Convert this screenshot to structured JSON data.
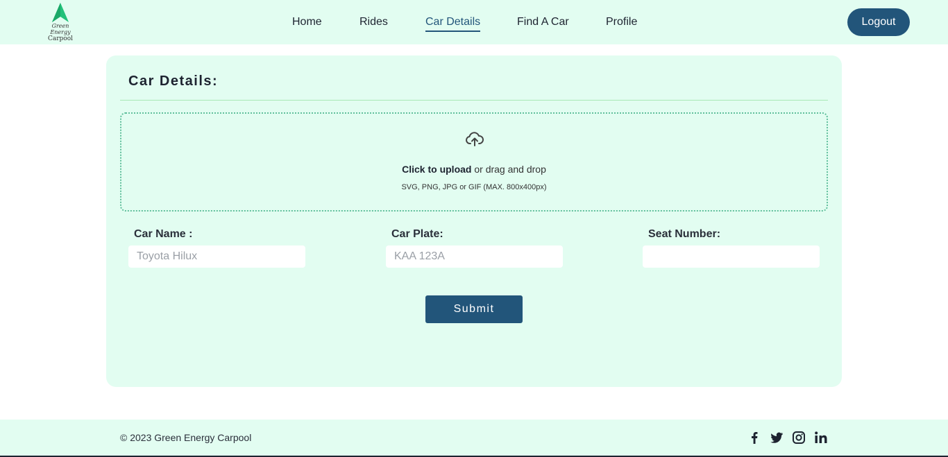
{
  "header": {
    "logo": {
      "line1": "Green Energy",
      "line2": "Carpool",
      "icon": "arrow-up-icon",
      "color": "#22c17a"
    },
    "nav": [
      {
        "label": "Home",
        "active": false
      },
      {
        "label": "Rides",
        "active": false
      },
      {
        "label": "Car Details",
        "active": true
      },
      {
        "label": "Find A Car",
        "active": false
      },
      {
        "label": "Profile",
        "active": false
      }
    ],
    "logout_label": "Logout"
  },
  "card": {
    "title": "Car Details:",
    "upload": {
      "icon": "cloud-upload-icon",
      "strong": "Click to upload",
      "rest": " or drag and drop",
      "hint": "SVG, PNG, JPG or GIF (MAX. 800x400px)"
    },
    "fields": [
      {
        "label": "Car Name :",
        "placeholder": "Toyota Hilux",
        "value": ""
      },
      {
        "label": "Car Plate:",
        "placeholder": "KAA 123A",
        "value": ""
      },
      {
        "label": "Seat Number:",
        "placeholder": "",
        "value": ""
      }
    ],
    "submit_label": "Submit"
  },
  "footer": {
    "copyright": "© 2023 Green Energy Carpool",
    "social": [
      "facebook-icon",
      "twitter-icon",
      "instagram-icon",
      "linkedin-icon"
    ]
  },
  "colors": {
    "accent": "#22557a",
    "panel": "#e2fdf1",
    "brand_green": "#22c17a"
  }
}
